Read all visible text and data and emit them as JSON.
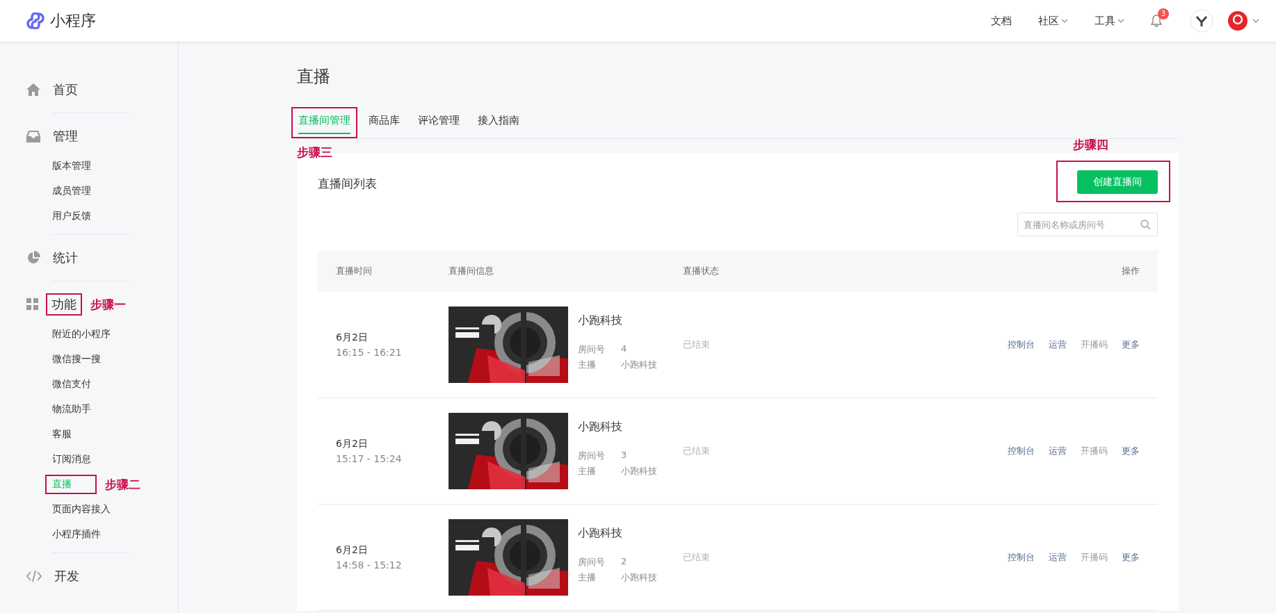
{
  "header": {
    "logo": "小程序",
    "nav": [
      {
        "label": "文档",
        "dropdown": false
      },
      {
        "label": "社区",
        "dropdown": true
      },
      {
        "label": "工具",
        "dropdown": true
      }
    ],
    "notifications": "3"
  },
  "sidebar": {
    "sections": [
      {
        "kind": "home",
        "title": "首页"
      },
      {
        "kind": "inbox",
        "title": "管理",
        "items": [
          {
            "label": "版本管理",
            "selected": false
          },
          {
            "label": "成员管理",
            "selected": false
          },
          {
            "label": "用户反馈",
            "selected": false
          }
        ]
      },
      {
        "kind": "pie",
        "title": "统计"
      },
      {
        "kind": "grid",
        "title": "功能",
        "step": "步骤一",
        "items": [
          {
            "label": "附近的小程序",
            "selected": false
          },
          {
            "label": "微信搜一搜",
            "selected": false
          },
          {
            "label": "微信支付",
            "selected": false
          },
          {
            "label": "物流助手",
            "selected": false
          },
          {
            "label": "客服",
            "selected": false
          },
          {
            "label": "订阅消息",
            "selected": false
          },
          {
            "label": "直播",
            "selected": true,
            "step": "步骤二"
          },
          {
            "label": "页面内容接入",
            "selected": false
          },
          {
            "label": "小程序插件",
            "selected": false
          }
        ]
      },
      {
        "kind": "code",
        "title": "开发"
      }
    ]
  },
  "page": {
    "title": "直播",
    "tabs": [
      {
        "label": "直播间管理",
        "selected": true,
        "step": "步骤三"
      },
      {
        "label": "商品库",
        "selected": false
      },
      {
        "label": "评论管理",
        "selected": false
      },
      {
        "label": "接入指南",
        "selected": false
      }
    ]
  },
  "card": {
    "title": "直播间列表",
    "create_button": {
      "label": "创建直播间",
      "step": "步骤四"
    },
    "search": {
      "placeholder": "直播间名称或房间号"
    },
    "table": {
      "columns": [
        "直播时间",
        "直播间信息",
        "直播状态",
        "操作"
      ],
      "rows": [
        {
          "date": "6月2日",
          "time": "16:15 - 16:21",
          "name": "小跑科技",
          "room_label": "房间号",
          "room": "4",
          "host_label": "主播",
          "host": "小跑科技",
          "status": "已结束",
          "actions": [
            {
              "label": "控制台",
              "disabled": false
            },
            {
              "label": "运营",
              "disabled": false
            },
            {
              "label": "开播码",
              "disabled": true
            },
            {
              "label": "更多",
              "disabled": false
            }
          ]
        },
        {
          "date": "6月2日",
          "time": "15:17 - 15:24",
          "name": "小跑科技",
          "room_label": "房间号",
          "room": "3",
          "host_label": "主播",
          "host": "小跑科技",
          "status": "已结束",
          "actions": [
            {
              "label": "控制台",
              "disabled": false
            },
            {
              "label": "运营",
              "disabled": false
            },
            {
              "label": "开播码",
              "disabled": true
            },
            {
              "label": "更多",
              "disabled": false
            }
          ]
        },
        {
          "date": "6月2日",
          "time": "14:58 - 15:12",
          "name": "小跑科技",
          "room_label": "房间号",
          "room": "2",
          "host_label": "主播",
          "host": "小跑科技",
          "status": "已结束",
          "actions": [
            {
              "label": "控制台",
              "disabled": false
            },
            {
              "label": "运营",
              "disabled": false
            },
            {
              "label": "开播码",
              "disabled": true
            },
            {
              "label": "更多",
              "disabled": false
            }
          ]
        }
      ]
    }
  }
}
